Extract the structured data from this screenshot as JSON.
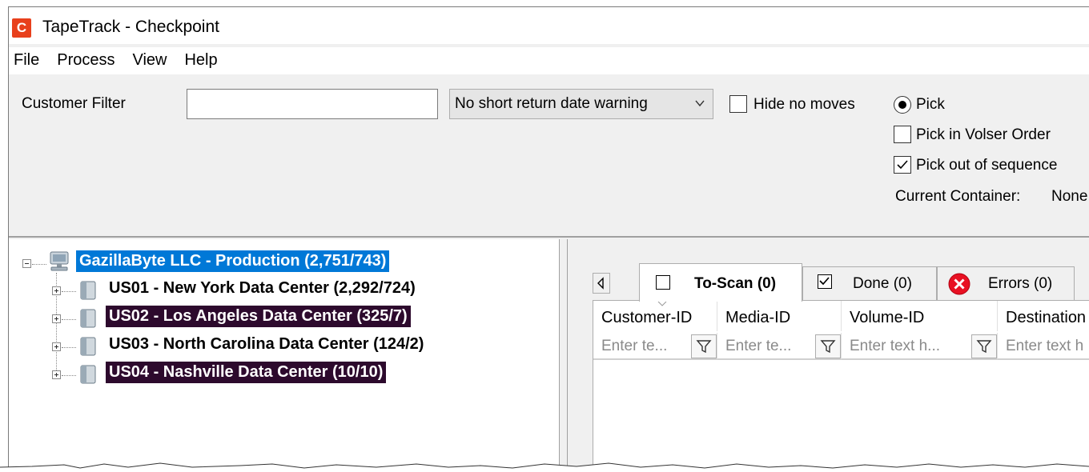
{
  "window": {
    "title": "TapeTrack - Checkpoint",
    "app_icon_letter": "C"
  },
  "menu": [
    "File",
    "Process",
    "View",
    "Help"
  ],
  "toolbar": {
    "customer_filter_label": "Customer Filter",
    "customer_filter_value": "",
    "warning_select": "No short return date warning",
    "hide_no_moves_label": "Hide no moves",
    "hide_no_moves_checked": false,
    "pick_label": "Pick",
    "pick_selected": true,
    "pick_volser_label": "Pick in Volser Order",
    "pick_volser_checked": false,
    "pick_out_of_sequence_label": "Pick out of sequence",
    "pick_out_of_sequence_checked": true,
    "current_container_label": "Current Container:",
    "current_container_value": "None"
  },
  "tree": {
    "root": "GazillaByte LLC - Production (2,751/743)",
    "children": [
      "US01 - New York Data Center (2,292/724)",
      "US02 - Los Angeles Data Center (325/7)",
      "US03 - North Carolina Data Center (124/2)",
      "US04 - Nashville Data Center (10/10)"
    ]
  },
  "tabs": [
    {
      "label": "To-Scan (0)",
      "active": true
    },
    {
      "label": "Done (0)",
      "active": false
    },
    {
      "label": "Errors (0)",
      "active": false
    }
  ],
  "grid": {
    "columns": [
      "Customer-ID",
      "Media-ID",
      "Volume-ID",
      "Destination"
    ],
    "filter_placeholders": [
      "Enter te...",
      "Enter te...",
      "Enter text h...",
      "Enter text h"
    ]
  },
  "colors": {
    "selection_blue": "#0078d7",
    "highlight_dark": "#2d0a2d",
    "error_red": "#e81123",
    "app_icon": "#e8401c"
  }
}
